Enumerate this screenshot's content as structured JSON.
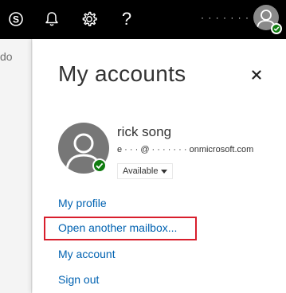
{
  "topbar": {
    "icons": {
      "skype": "skype-icon",
      "notifications": "bell-icon",
      "settings": "gear-icon",
      "help": "?"
    },
    "username": "· · · · · · · · ·"
  },
  "background": {
    "fragment_text": "do"
  },
  "panel": {
    "title": "My accounts",
    "close_label": "×",
    "profile": {
      "name": "rick song",
      "email": "e · · · @ · · · · · · · onmicrosoft.com",
      "status": "Available"
    },
    "links": {
      "my_profile": "My profile",
      "open_mailbox": "Open another mailbox...",
      "my_account": "My account",
      "sign_out": "Sign out"
    }
  },
  "colors": {
    "topbar": "#000000",
    "link": "#0062b1",
    "presence": "#107c10",
    "highlight": "#d81e2c"
  }
}
